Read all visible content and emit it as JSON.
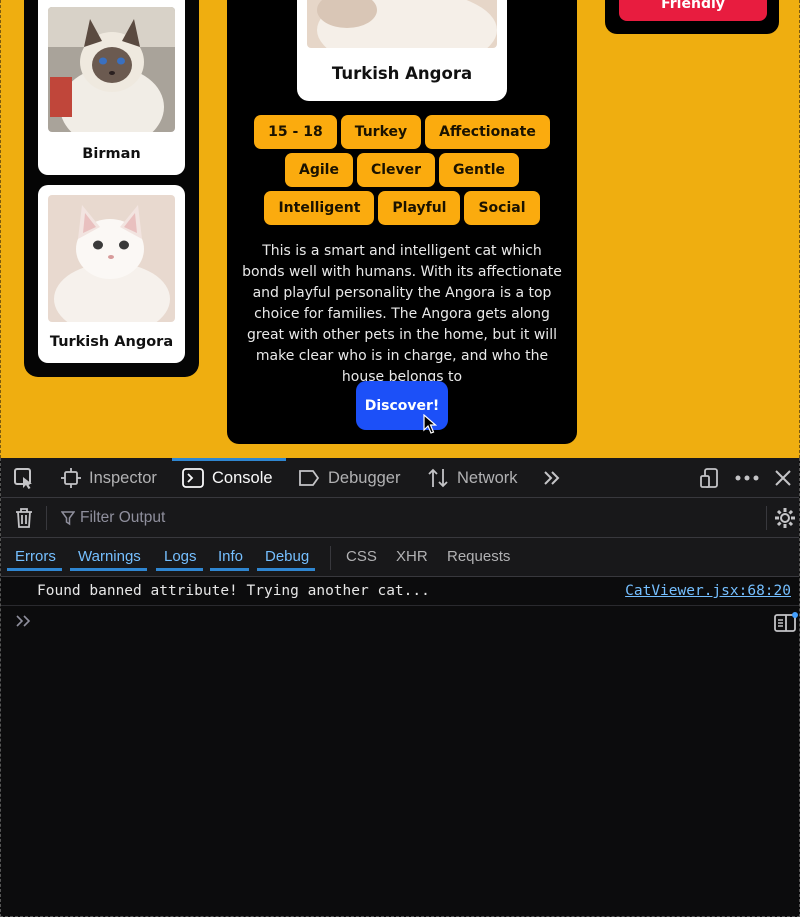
{
  "app": {
    "sidebar_cats": [
      {
        "name": "Birman"
      },
      {
        "name": "Turkish Angora"
      }
    ],
    "detail": {
      "cat_name": "Turkish Angora",
      "tags": [
        "15 - 18",
        "Turkey",
        "Affectionate",
        "Agile",
        "Clever",
        "Gentle",
        "Intelligent",
        "Playful",
        "Social"
      ],
      "description": "This is a smart and intelligent cat which bonds well with humans. With its affectionate and playful personality the Angora is a top choice for families. The Angora gets along great with other pets in the home, but it will make clear who is in charge, and who the house belongs to",
      "discover_label": "Discover!"
    },
    "right_panel": {
      "button_label": "Friendly"
    },
    "colors": {
      "background": "#efae10",
      "tag": "#fbab0e",
      "discover": "#1c50f8",
      "friendly": "#e81c3f"
    }
  },
  "devtools": {
    "tabs": {
      "inspector": "Inspector",
      "console": "Console",
      "debugger": "Debugger",
      "network": "Network"
    },
    "filter_placeholder": "Filter Output",
    "levels": {
      "errors": "Errors",
      "warnings": "Warnings",
      "logs": "Logs",
      "info": "Info",
      "debug": "Debug"
    },
    "extra_filters": {
      "css": "CSS",
      "xhr": "XHR",
      "requests": "Requests"
    },
    "messages": [
      {
        "text": "Found banned attribute! Trying another cat...",
        "source": "CatViewer.jsx:68:20"
      }
    ],
    "active_tab": "Console"
  }
}
